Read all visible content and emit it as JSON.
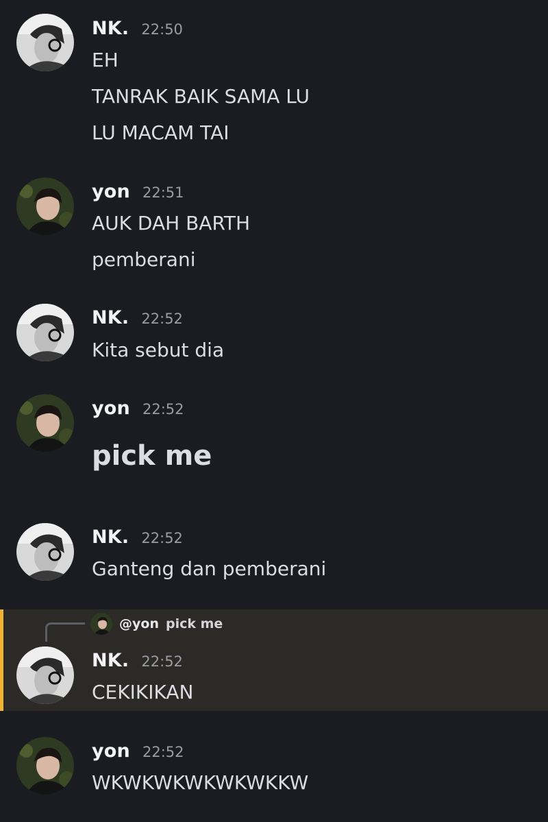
{
  "users": {
    "nk": {
      "name": "NK.",
      "avatar_icon": "nk-avatar-icon"
    },
    "yon": {
      "name": "yon",
      "avatar_icon": "yon-avatar-icon"
    }
  },
  "messages": [
    {
      "author": "NK.",
      "time": "22:50",
      "lines": [
        "EH",
        "TANRAK BAIK SAMA LU",
        "LU MACAM TAI"
      ]
    },
    {
      "author": "yon",
      "time": "22:51",
      "lines": [
        "AUK DAH BARTH",
        "pemberani"
      ]
    },
    {
      "author": "NK.",
      "time": "22:52",
      "lines": [
        "Kita sebut dia"
      ]
    },
    {
      "author": "yon",
      "time": "22:52",
      "lines": [
        "pick me"
      ]
    },
    {
      "author": "NK.",
      "time": "22:52",
      "lines": [
        "Ganteng dan pemberani"
      ]
    },
    {
      "author": "NK.",
      "time": "22:52",
      "reply_to": {
        "author": "@yon",
        "text": "pick me"
      },
      "lines": [
        "CEKIKIKAN"
      ]
    },
    {
      "author": "yon",
      "time": "22:52",
      "lines": [
        "WKWKWKWKWKWKKW"
      ]
    }
  ],
  "colors": {
    "background": "#1b1c21",
    "reply_highlight": "#2b2a27",
    "reply_accent": "#f0b232",
    "author_text": "#f2f3f5",
    "timestamp_text": "#9a9ca4",
    "message_text": "#dcdde1"
  }
}
